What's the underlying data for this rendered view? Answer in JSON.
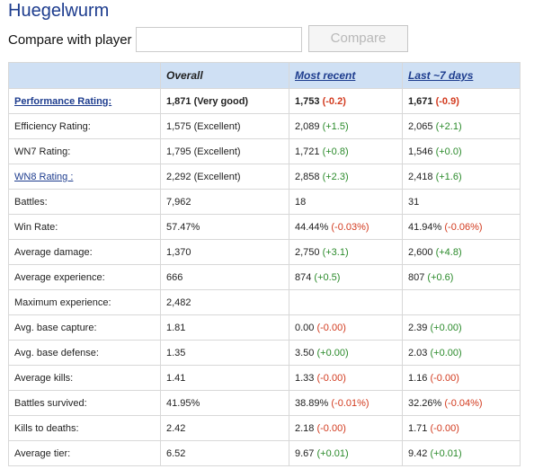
{
  "player_name": "Huegelwurm",
  "compare": {
    "label": "Compare with player",
    "input_value": "",
    "button_label": "Compare"
  },
  "table": {
    "headers": [
      "",
      "Overall",
      "Most recent",
      "Last ~7 days"
    ],
    "rows": [
      {
        "label": "Performance Rating:",
        "overall": "1,871 (Very good)",
        "recent": "1,753",
        "recent_delta": "(-0.2)",
        "recent_sign": "neg",
        "week": "1,671",
        "week_delta": "(-0.9)",
        "week_sign": "neg"
      },
      {
        "label": "Efficiency Rating:",
        "overall": "1,575 (Excellent)",
        "recent": "2,089",
        "recent_delta": "(+1.5)",
        "recent_sign": "pos",
        "week": "2,065",
        "week_delta": "(+2.1)",
        "week_sign": "pos"
      },
      {
        "label": "WN7 Rating:",
        "overall": "1,795 (Excellent)",
        "recent": "1,721",
        "recent_delta": "(+0.8)",
        "recent_sign": "pos",
        "week": "1,546",
        "week_delta": "(+0.0)",
        "week_sign": "pos"
      },
      {
        "label": "WN8 Rating :",
        "overall": "2,292 (Excellent)",
        "recent": "2,858",
        "recent_delta": "(+2.3)",
        "recent_sign": "pos",
        "week": "2,418",
        "week_delta": "(+1.6)",
        "week_sign": "pos"
      },
      {
        "label": "Battles:",
        "overall": "7,962",
        "recent": "18",
        "recent_delta": "",
        "recent_sign": "",
        "week": "31",
        "week_delta": "",
        "week_sign": ""
      },
      {
        "label": "Win Rate:",
        "overall": "57.47%",
        "recent": "44.44%",
        "recent_delta": "(-0.03%)",
        "recent_sign": "neg",
        "week": "41.94%",
        "week_delta": "(-0.06%)",
        "week_sign": "neg"
      },
      {
        "label": "Average damage:",
        "overall": "1,370",
        "recent": "2,750",
        "recent_delta": "(+3.1)",
        "recent_sign": "pos",
        "week": "2,600",
        "week_delta": "(+4.8)",
        "week_sign": "pos"
      },
      {
        "label": "Average experience:",
        "overall": "666",
        "recent": "874",
        "recent_delta": "(+0.5)",
        "recent_sign": "pos",
        "week": "807",
        "week_delta": "(+0.6)",
        "week_sign": "pos"
      },
      {
        "label": "Maximum experience:",
        "overall": "2,482",
        "recent": "",
        "recent_delta": "",
        "recent_sign": "",
        "week": "",
        "week_delta": "",
        "week_sign": ""
      },
      {
        "label": "Avg. base capture:",
        "overall": "1.81",
        "recent": "0.00",
        "recent_delta": "(-0.00)",
        "recent_sign": "neg",
        "week": "2.39",
        "week_delta": "(+0.00)",
        "week_sign": "pos"
      },
      {
        "label": "Avg. base defense:",
        "overall": "1.35",
        "recent": "3.50",
        "recent_delta": "(+0.00)",
        "recent_sign": "pos",
        "week": "2.03",
        "week_delta": "(+0.00)",
        "week_sign": "pos"
      },
      {
        "label": "Average kills:",
        "overall": "1.41",
        "recent": "1.33",
        "recent_delta": "(-0.00)",
        "recent_sign": "neg",
        "week": "1.16",
        "week_delta": "(-0.00)",
        "week_sign": "neg"
      },
      {
        "label": "Battles survived:",
        "overall": "41.95%",
        "recent": "38.89%",
        "recent_delta": "(-0.01%)",
        "recent_sign": "neg",
        "week": "32.26%",
        "week_delta": "(-0.04%)",
        "week_sign": "neg"
      },
      {
        "label": "Kills to deaths:",
        "overall": "2.42",
        "recent": "2.18",
        "recent_delta": "(-0.00)",
        "recent_sign": "neg",
        "week": "1.71",
        "week_delta": "(-0.00)",
        "week_sign": "neg"
      },
      {
        "label": "Average tier:",
        "overall": "6.52",
        "recent": "9.67",
        "recent_delta": "(+0.01)",
        "recent_sign": "pos",
        "week": "9.42",
        "week_delta": "(+0.01)",
        "week_sign": "pos"
      }
    ]
  },
  "colors": {
    "title": "#1d3c8e",
    "header_bg": "#cfe0f4",
    "positive": "#2a8a2a",
    "negative": "#d23a1e"
  }
}
